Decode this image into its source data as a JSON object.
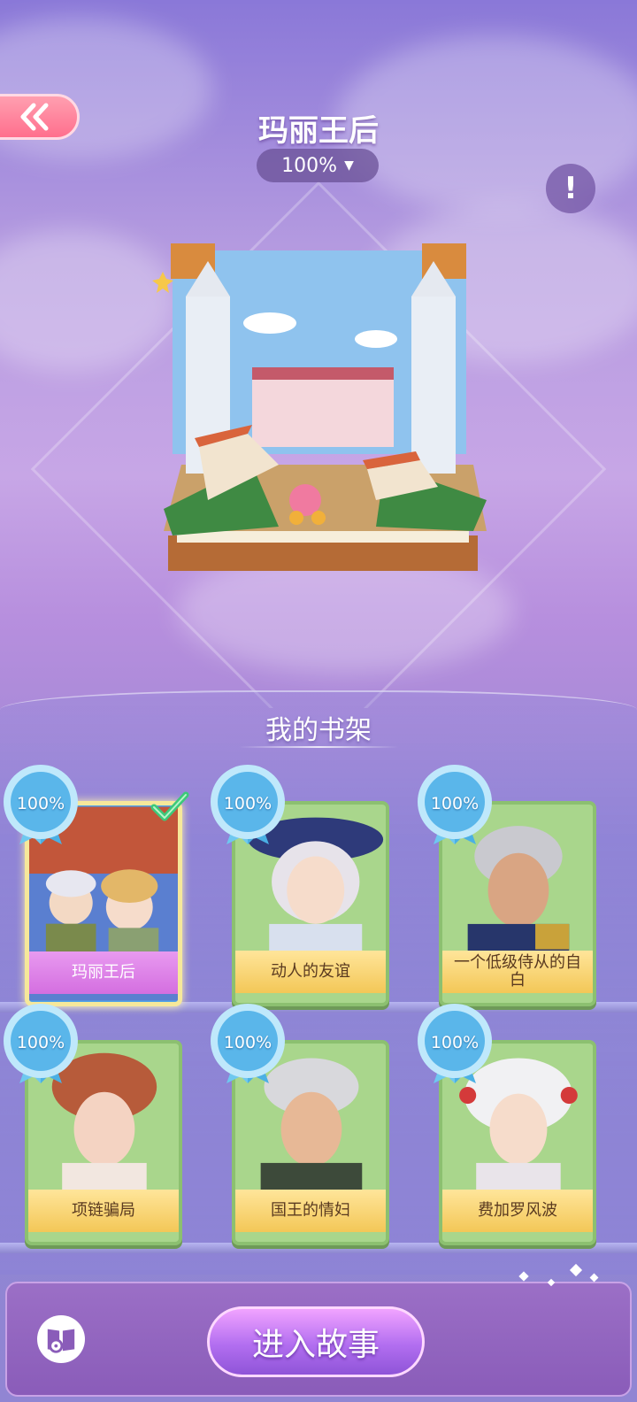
{
  "header": {
    "title": "玛丽王后",
    "progress": "100%",
    "info_symbol": "!"
  },
  "shelf": {
    "title": "我的书架",
    "books": [
      {
        "name": "玛丽王后",
        "progress": "100%",
        "selected": true
      },
      {
        "name": "动人的友谊",
        "progress": "100%",
        "selected": false
      },
      {
        "name": "一个低级侍从的自白",
        "progress": "100%",
        "selected": false
      },
      {
        "name": "项链骗局",
        "progress": "100%",
        "selected": false
      },
      {
        "name": "国王的情妇",
        "progress": "100%",
        "selected": false
      },
      {
        "name": "费加罗风波",
        "progress": "100%",
        "selected": false
      }
    ]
  },
  "bottom": {
    "enter_label": "进入故事"
  },
  "icons": {
    "back": "double-chevron-left-icon",
    "info": "exclamation-icon",
    "check": "checkmark-icon",
    "settings": "book-gear-icon"
  },
  "colors": {
    "accent_pink": "#ff6f8d",
    "selected_label": "#d46ee0",
    "badge_blue": "#57b5ea",
    "card_green": "#a9d68c"
  }
}
